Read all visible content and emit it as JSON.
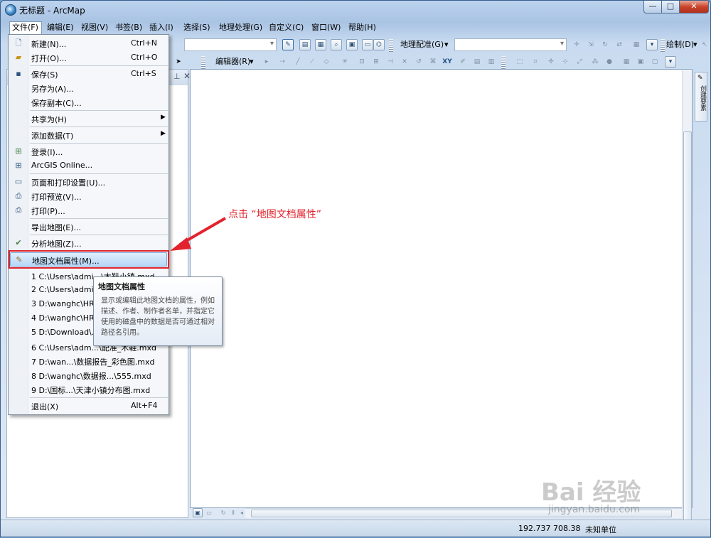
{
  "window": {
    "title": "无标题 - ArcMap",
    "controls": {
      "minimize": "—",
      "maximize": "□",
      "close": "✕"
    }
  },
  "menubar": {
    "items": [
      "文件(F)",
      "编辑(E)",
      "视图(V)",
      "书签(B)",
      "插入(I)",
      "选择(S)",
      "地理处理(G)",
      "自定义(C)",
      "窗口(W)",
      "帮助(H)"
    ]
  },
  "toolbar": {
    "georef_label": "地理配准(G)",
    "draw_label": "绘制(D)",
    "editor_label": "编辑器(R)",
    "xy_label": "XY"
  },
  "file_menu": {
    "items": [
      {
        "label": "新建(N)...",
        "shortcut": "Ctrl+N",
        "icon": "new-document-icon"
      },
      {
        "label": "打开(O)...",
        "shortcut": "Ctrl+O",
        "icon": "open-folder-icon"
      },
      {
        "label": "保存(S)",
        "shortcut": "Ctrl+S",
        "icon": "save-icon"
      },
      {
        "label": "另存为(A)...",
        "shortcut": ""
      },
      {
        "label": "保存副本(C)...",
        "shortcut": ""
      },
      {
        "label": "共享为(H)",
        "shortcut": "",
        "submenu": true
      },
      {
        "label": "添加数据(T)",
        "shortcut": "",
        "submenu": true
      },
      {
        "label": "登录(I)...",
        "shortcut": "",
        "icon": "sign-in-icon"
      },
      {
        "label": "ArcGIS Online...",
        "shortcut": "",
        "icon": "arcgis-online-icon"
      },
      {
        "label": "页面和打印设置(U)...",
        "shortcut": "",
        "icon": "page-setup-icon"
      },
      {
        "label": "打印预览(V)...",
        "shortcut": "",
        "icon": "print-preview-icon"
      },
      {
        "label": "打印(P)...",
        "shortcut": "",
        "icon": "printer-icon"
      },
      {
        "label": "导出地图(E)...",
        "shortcut": ""
      },
      {
        "label": "分析地图(Z)...",
        "shortcut": "",
        "icon": "analyze-map-icon"
      },
      {
        "label": "地图文档属性(M)...",
        "shortcut": "",
        "icon": "document-properties-icon"
      },
      {
        "label": "1 C:\\Users\\admi...\\木鞋小镇.mxd",
        "shortcut": ""
      },
      {
        "label": "2 C:\\Users\\admi...",
        "shortcut": ""
      },
      {
        "label": "3 D:\\wanghc\\HR...",
        "shortcut": ""
      },
      {
        "label": "4 D:\\wanghc\\HR...",
        "shortcut": ""
      },
      {
        "label": "5 D:\\Download\\...",
        "shortcut": ""
      },
      {
        "label": "6 C:\\Users\\adm...\\配准_木鞋.mxd",
        "shortcut": ""
      },
      {
        "label": "7 D:\\wan...\\数据报告_彩色图.mxd",
        "shortcut": ""
      },
      {
        "label": "8 D:\\wanghc\\数据报...\\555.mxd",
        "shortcut": ""
      },
      {
        "label": "9 D:\\国标...\\天津小镇分布图.mxd",
        "shortcut": ""
      },
      {
        "label": "退出(X)",
        "shortcut": "Alt+F4"
      }
    ]
  },
  "tooltip": {
    "title": "地图文档属性",
    "body": "显示或编辑此地图文档的属性，例如描述、作者、制作者名单，并指定它使用的磁盘中的数据是否可通过相对路径名引用。"
  },
  "annotation": {
    "text": "点击 “地图文档属性”"
  },
  "side_tab": {
    "label": "创建要素"
  },
  "statusbar": {
    "coords": "192.737  708.38",
    "units": "未知单位"
  },
  "watermark": {
    "logo": "Bai 经验",
    "url": "jingyan.baidu.com"
  },
  "colors": {
    "highlight_red": "#e2232d",
    "menu_hover": "#b7d7f7"
  }
}
